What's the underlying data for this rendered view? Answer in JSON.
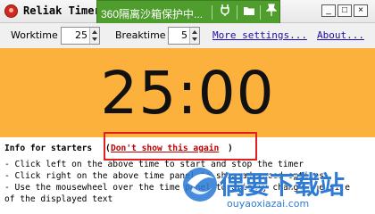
{
  "window": {
    "title": "Reliak Timer",
    "controls": {
      "minimize": "_",
      "maximize": "□",
      "close": "×"
    }
  },
  "sandbox_bar": {
    "text": "360隔离沙箱保护中...",
    "icons": [
      "plug-icon",
      "folder-icon",
      "pin-icon"
    ],
    "color": "#4f9d2d"
  },
  "toolbar": {
    "worktime_label": "Worktime",
    "worktime_value": "25",
    "breaktime_label": "Breaktime",
    "breaktime_value": "5",
    "more_settings": "More settings...",
    "about": "About..."
  },
  "timer": {
    "display": "25:00",
    "background": "#fbb13c"
  },
  "info": {
    "heading": "Info for starters",
    "open_paren": "(",
    "dont_show": "Don't show this again",
    "close_paren": ")",
    "lines": [
      "- Click left on the above time to start and stop the timer",
      "- Click right on the above time panel to show advanced options",
      "- Use the mousewheel over the time panel to quickly change the size",
      "  of the displayed text"
    ]
  },
  "watermark": {
    "brand": "偶要下载站",
    "url": "ouyaoxiazai.com"
  },
  "accent": "#e02020"
}
